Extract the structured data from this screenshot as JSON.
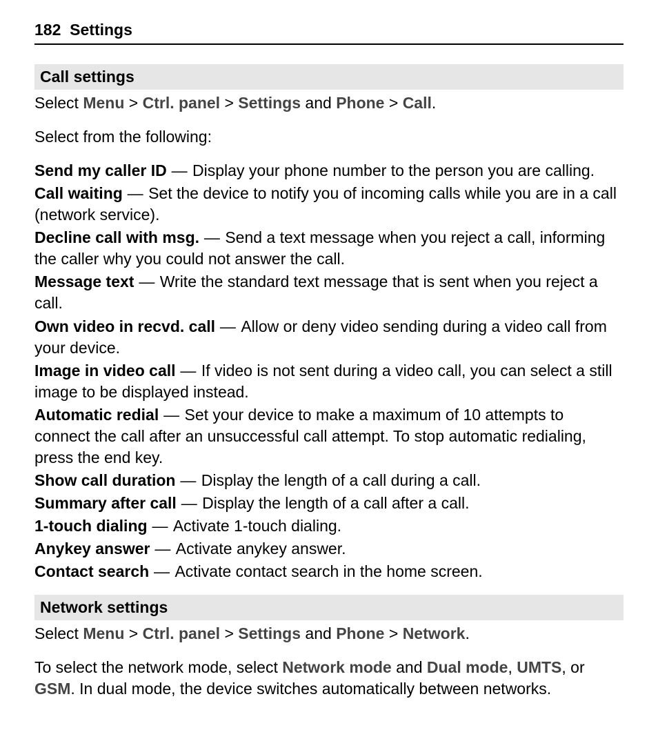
{
  "header": {
    "page_number": "182",
    "section": "Settings"
  },
  "s1": {
    "title": "Call settings",
    "nav_prefix": "Select ",
    "nav_menu": "Menu",
    "nav_gt1": " > ",
    "nav_ctrl": "Ctrl. panel",
    "nav_gt2": " > ",
    "nav_settings": "Settings",
    "nav_and": " and ",
    "nav_phone": "Phone",
    "nav_gt3": " > ",
    "nav_call": "Call",
    "nav_period": ".",
    "intro": "Select from the following:",
    "items": [
      {
        "term": "Send my caller ID",
        "desc": "Display your phone number to the person you are calling."
      },
      {
        "term": "Call waiting",
        "desc": "Set the device to notify you of incoming calls while you are in a call (network service)."
      },
      {
        "term": "Decline call with msg.",
        "desc": "Send a text message when you reject a call, informing the caller why you could not answer the call."
      },
      {
        "term": "Message text",
        "desc": "Write the standard text message that is sent when you reject a call."
      },
      {
        "term": "Own video in recvd. call",
        "desc": "Allow or deny video sending during a video call from your device."
      },
      {
        "term": "Image in video call",
        "desc": "If video is not sent during a video call, you can select a still image to be displayed instead."
      },
      {
        "term": "Automatic redial",
        "desc": "Set your device to make a maximum of 10 attempts to connect the call after an unsuccessful call attempt. To stop automatic redialing, press the end key."
      },
      {
        "term": "Show call duration",
        "desc": "Display the length of a call during a call."
      },
      {
        "term": "Summary after call",
        "desc": "Display the length of a call after a call."
      },
      {
        "term": "1-touch dialing",
        "desc": "Activate 1-touch dialing."
      },
      {
        "term": "Anykey answer",
        "desc": "Activate anykey answer."
      },
      {
        "term": "Contact search",
        "desc": "Activate contact search in the home screen."
      }
    ]
  },
  "s2": {
    "title": "Network settings",
    "nav_prefix": "Select ",
    "nav_menu": "Menu",
    "nav_gt1": " > ",
    "nav_ctrl": "Ctrl. panel",
    "nav_gt2": " > ",
    "nav_settings": "Settings",
    "nav_and": " and ",
    "nav_phone": "Phone",
    "nav_gt3": " > ",
    "nav_network": "Network",
    "nav_period": ".",
    "body_p1a": "To select the network mode, select ",
    "body_netmode": "Network mode",
    "body_and": " and ",
    "body_dual": "Dual mode",
    "body_comma1": ", ",
    "body_umts": "UMTS",
    "body_or": ", or ",
    "body_gsm": "GSM",
    "body_p1b": ". In dual mode, the device switches automatically between networks."
  },
  "dash": " — "
}
